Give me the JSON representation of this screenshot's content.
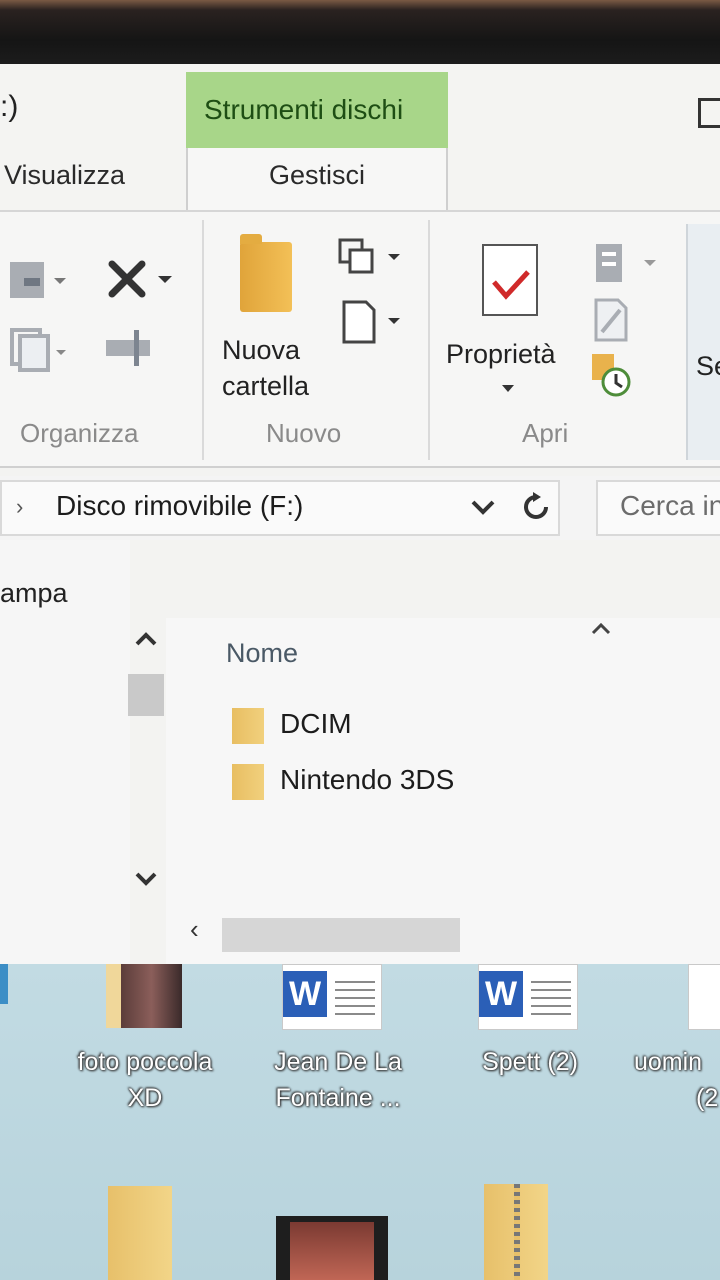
{
  "window": {
    "title_fragment": ":)",
    "context_tab_header": "Strumenti dischi",
    "tabs": [
      "Visualizza",
      "Gestisci"
    ]
  },
  "ribbon": {
    "new_folder_label": "Nuova cartella",
    "properties_label": "Proprietà",
    "cut_off_label": "Se",
    "groups": [
      "Organizza",
      "Nuovo",
      "Apri"
    ]
  },
  "address": {
    "path": "Disco rimovibile (F:)",
    "search_placeholder": "Cerca in"
  },
  "nav_pane": {
    "item_fragment": "ampa"
  },
  "file_list": {
    "column_header": "Nome",
    "items": [
      {
        "name": "DCIM",
        "icon": "folder-icon"
      },
      {
        "name": "Nintendo 3DS",
        "icon": "folder-icon"
      }
    ]
  },
  "desktop": {
    "icons": [
      {
        "label_line1": "foto poccola",
        "label_line2": "XD",
        "icon": "image-file-icon"
      },
      {
        "label_line1": "Jean De La",
        "label_line2": "Fontaine ...",
        "icon": "word-document-icon"
      },
      {
        "label_line1": "Spett (2)",
        "label_line2": "",
        "icon": "word-document-icon"
      },
      {
        "label_line1": "uomin",
        "label_line2": "(2",
        "icon": "document-icon"
      }
    ],
    "word_letter": "W"
  },
  "colors": {
    "context_tab": "#a8d689",
    "folder": "#f3c057",
    "word_blue": "#2b5fb7",
    "properties_check": "#d02a2a"
  }
}
